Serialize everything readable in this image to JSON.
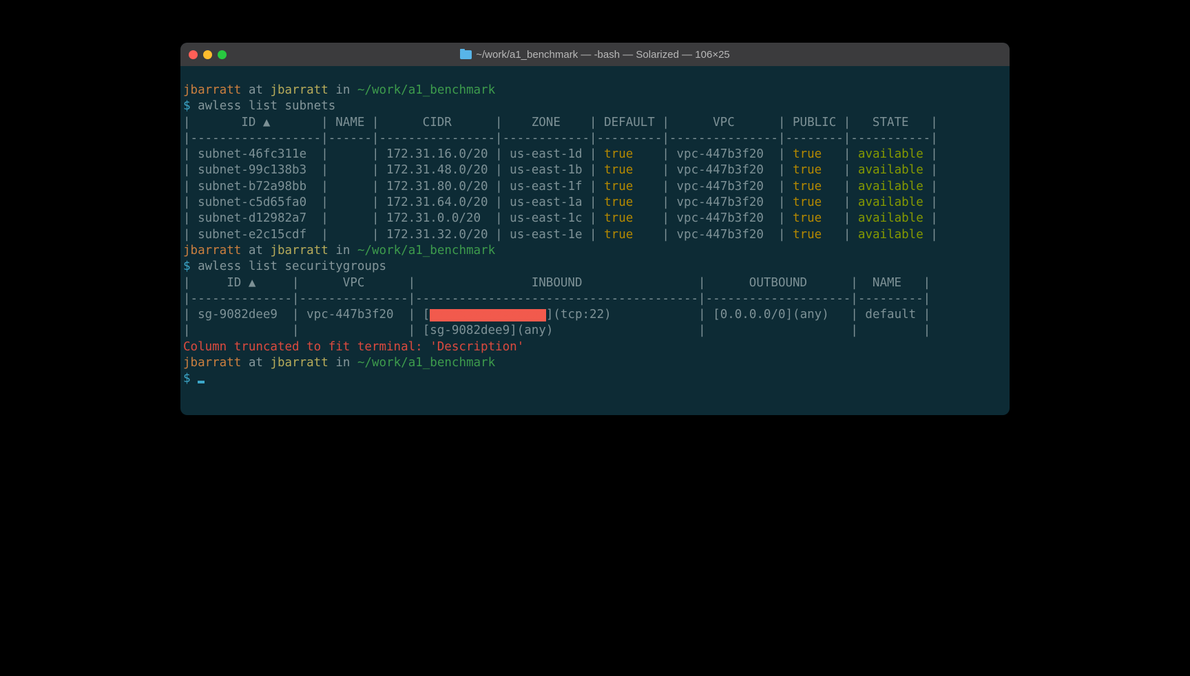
{
  "window": {
    "title": "~/work/a1_benchmark — -bash — Solarized — 106×25"
  },
  "prompt": {
    "user": "jbarratt",
    "at": "at",
    "host": "jbarratt",
    "in": "in",
    "path": "~/work/a1_benchmark",
    "symbol": "$"
  },
  "cmd1": "awless list subnets",
  "cmd2": "awless list securitygroups",
  "subnets": {
    "header": "|       ID ▲       | NAME |      CIDR      |    ZONE    | DEFAULT |      VPC      | PUBLIC |   STATE   |",
    "divider": "|------------------|------|----------------|------------|---------|---------------|--------|-----------|",
    "rows": [
      {
        "id": "subnet-46fc311e",
        "name": "",
        "cidr": "172.31.16.0/20",
        "zone": "us-east-1d",
        "default": "true",
        "vpc": "vpc-447b3f20",
        "public": "true",
        "state": "available"
      },
      {
        "id": "subnet-99c138b3",
        "name": "",
        "cidr": "172.31.48.0/20",
        "zone": "us-east-1b",
        "default": "true",
        "vpc": "vpc-447b3f20",
        "public": "true",
        "state": "available"
      },
      {
        "id": "subnet-b72a98bb",
        "name": "",
        "cidr": "172.31.80.0/20",
        "zone": "us-east-1f",
        "default": "true",
        "vpc": "vpc-447b3f20",
        "public": "true",
        "state": "available"
      },
      {
        "id": "subnet-c5d65fa0",
        "name": "",
        "cidr": "172.31.64.0/20",
        "zone": "us-east-1a",
        "default": "true",
        "vpc": "vpc-447b3f20",
        "public": "true",
        "state": "available"
      },
      {
        "id": "subnet-d12982a7",
        "name": "",
        "cidr": "172.31.0.0/20",
        "zone": "us-east-1c",
        "default": "true",
        "vpc": "vpc-447b3f20",
        "public": "true",
        "state": "available"
      },
      {
        "id": "subnet-e2c15cdf",
        "name": "",
        "cidr": "172.31.32.0/20",
        "zone": "us-east-1e",
        "default": "true",
        "vpc": "vpc-447b3f20",
        "public": "true",
        "state": "available"
      }
    ]
  },
  "sg": {
    "header": "|     ID ▲     |      VPC      |                INBOUND                |      OUTBOUND      |  NAME   |",
    "divider": "|--------------|---------------|---------------------------------------|--------------------|---------|",
    "row1": {
      "id": "sg-9082dee9",
      "vpc": "vpc-447b3f20",
      "inbound_prefix": "[",
      "inbound_redacted": "XXXXXXXXXXXXXXXX",
      "inbound_suffix": "](tcp:22)",
      "outbound": "[0.0.0.0/0](any)",
      "name": "default"
    },
    "row2": {
      "inbound": "[sg-9082dee9](any)"
    },
    "truncated": "Column truncated to fit terminal: 'Description'"
  }
}
